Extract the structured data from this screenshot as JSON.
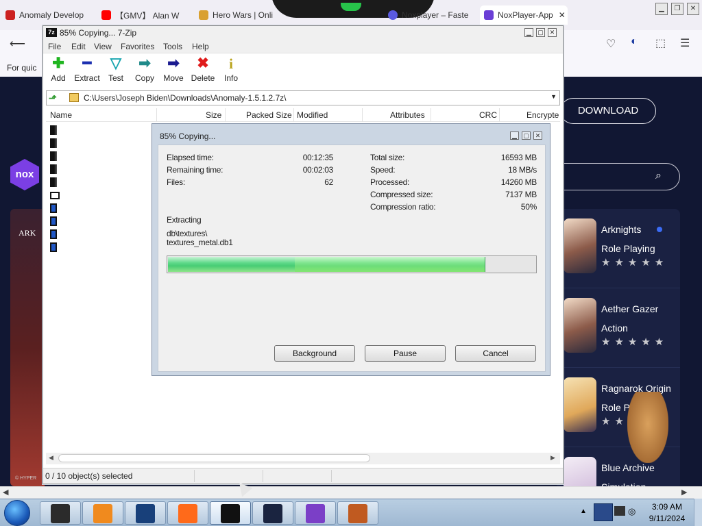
{
  "browser": {
    "tabs": [
      {
        "label": "Anomaly Develop",
        "color": "#cc2020"
      },
      {
        "label": "【GMV】 Alan W",
        "color": "#ff0000"
      },
      {
        "label": "Hero Wars | Onli",
        "color": "#d9a030"
      },
      {
        "label": "Noxplayer – Faste",
        "color": "#5a5ae0"
      },
      {
        "label": "NoxPlayer-App",
        "color": "#6b3fd6"
      }
    ],
    "bookmarks_text": "For quic",
    "download_label": "DOWNLOAD",
    "side_art_text": "ARK",
    "side_small_text": "© HYPER"
  },
  "nox": {
    "logo_text": "nox",
    "games": [
      {
        "name": "Arknights",
        "genre": "Role Playing",
        "stars": "★★★★★",
        "new": true
      },
      {
        "name": "Aether Gazer",
        "genre": "Action",
        "stars": "★★★★★",
        "new": false
      },
      {
        "name": "Ragnarok Origin",
        "genre": "Role P",
        "stars": "★★★",
        "new": false
      },
      {
        "name": "Blue Archive",
        "genre": "Simulation",
        "stars": "",
        "new": false
      }
    ]
  },
  "zip": {
    "title": "85% Copying... 7-Zip",
    "title_icon": "7z",
    "menu": [
      "File",
      "Edit",
      "View",
      "Favorites",
      "Tools",
      "Help"
    ],
    "toolbar": [
      {
        "label": "Add",
        "icon": "plus-icon",
        "glyph": "✚",
        "color": "#1fb51f"
      },
      {
        "label": "Extract",
        "icon": "minus-icon",
        "glyph": "━",
        "color": "#1b2fb0"
      },
      {
        "label": "Test",
        "icon": "check-icon",
        "glyph": "▽",
        "color": "#1aa6b0"
      },
      {
        "label": "Copy",
        "icon": "copy-arrow-icon",
        "glyph": "➡",
        "color": "#1f8a8a"
      },
      {
        "label": "Move",
        "icon": "move-arrow-icon",
        "glyph": "➡",
        "color": "#1b1b90"
      },
      {
        "label": "Delete",
        "icon": "delete-x-icon",
        "glyph": "✖",
        "color": "#e01b1b"
      },
      {
        "label": "Info",
        "icon": "info-icon",
        "glyph": "i",
        "color": "#b8a21a"
      }
    ],
    "path": "C:\\Users\\Joseph Biden\\Downloads\\Anomaly-1.5.1.2.7z\\",
    "columns": [
      "Name",
      "Size",
      "Packed Size",
      "Modified",
      "Attributes",
      "CRC",
      "Encrypte"
    ],
    "file_icons": [
      "dark",
      "dark",
      "dark",
      "dark",
      "dark",
      "doc",
      "blue",
      "blue",
      "blue",
      "blue"
    ],
    "status": "0 / 10 object(s) selected"
  },
  "dialog": {
    "title": "85% Copying...",
    "left": [
      {
        "label": "Elapsed time:",
        "value": "00:12:35"
      },
      {
        "label": "Remaining time:",
        "value": "00:02:03"
      },
      {
        "label": "Files:",
        "value": "62"
      }
    ],
    "right": [
      {
        "label": "Total size:",
        "value": "16593 MB"
      },
      {
        "label": "Speed:",
        "value": "18 MB/s"
      },
      {
        "label": "Processed:",
        "value": "14260 MB"
      },
      {
        "label": "Compressed size:",
        "value": "7137 MB"
      },
      {
        "label": "Compression ratio:",
        "value": "50%"
      }
    ],
    "action": "Extracting",
    "current_path": "db\\textures\\",
    "current_file": "textures_metal.db1",
    "progress_percent": 86,
    "buttons": {
      "background": "Background",
      "pause": "Pause",
      "cancel": "Cancel"
    }
  },
  "taskbar": {
    "apps": [
      {
        "name": "taskbar-app-media-player",
        "color": "#2b2b2b",
        "active": false
      },
      {
        "name": "taskbar-app-vlc",
        "color": "#f08a1e",
        "active": false
      },
      {
        "name": "taskbar-app-network",
        "color": "#18407a",
        "active": false
      },
      {
        "name": "taskbar-app-firefox",
        "color": "#ff6a1a",
        "active": false
      },
      {
        "name": "taskbar-app-7zip",
        "color": "#111111",
        "active": true
      },
      {
        "name": "taskbar-app-monitor",
        "color": "#1a2440",
        "active": false
      },
      {
        "name": "taskbar-app-visual-studio",
        "color": "#7b3fc7",
        "active": false
      },
      {
        "name": "taskbar-app-game",
        "color": "#c05a20",
        "active": false
      }
    ],
    "time": "3:09 AM",
    "date": "9/11/2024"
  }
}
